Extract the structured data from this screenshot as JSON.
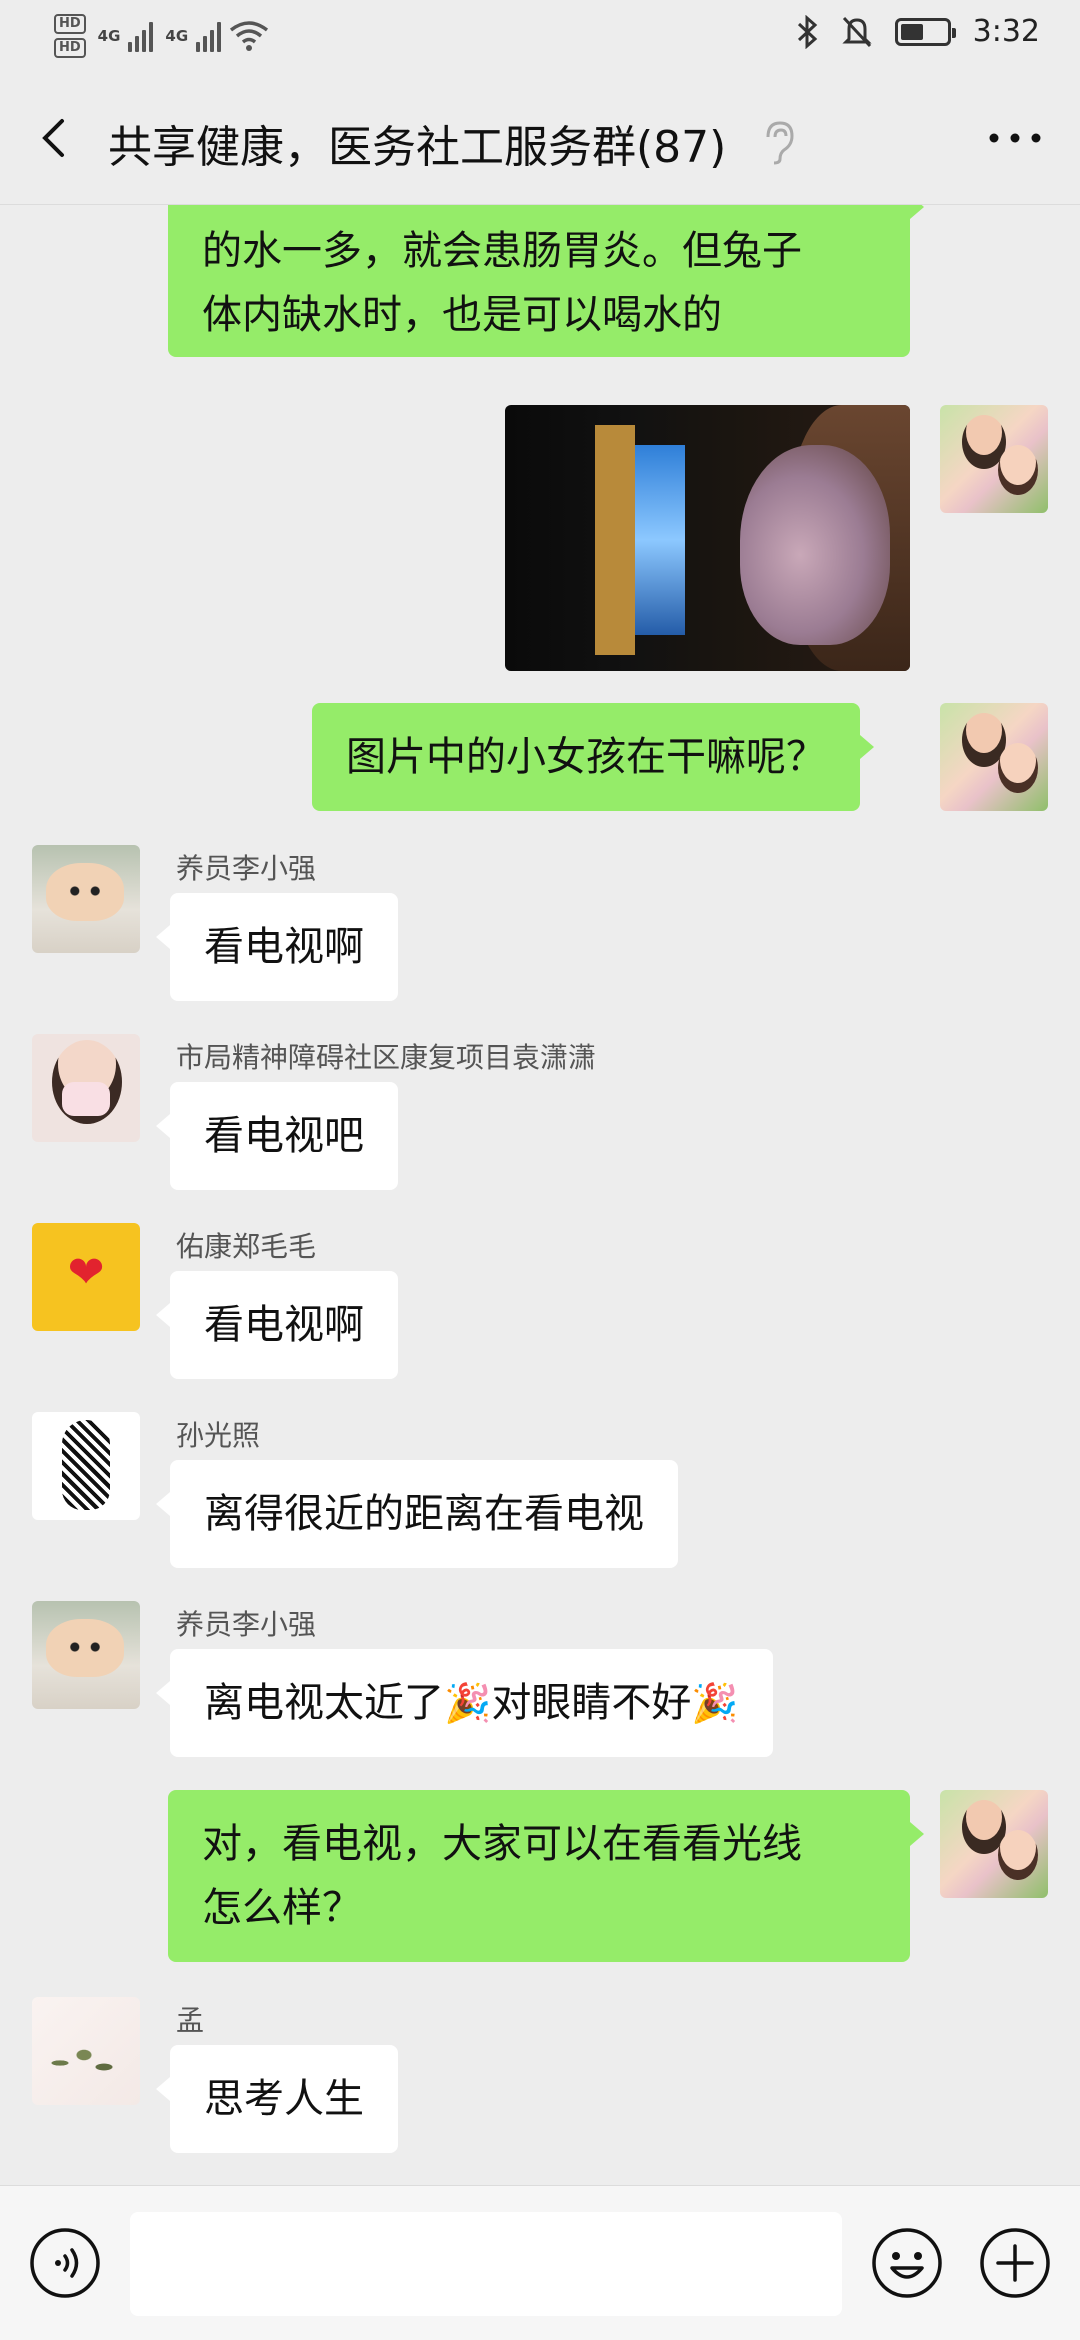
{
  "status_bar": {
    "hd1": "HD",
    "hd2": "HD",
    "net1": "4G",
    "net2": "4G",
    "time": "3:32",
    "icons": [
      "bluetooth-icon",
      "mute-bell-icon",
      "battery-icon",
      "wifi-icon",
      "signal-icon"
    ]
  },
  "header": {
    "title": "共享健康，医务社工服务群(87)",
    "icons": [
      "back-icon",
      "ear-icon",
      "more-icon"
    ]
  },
  "messages": [
    {
      "direction": "out",
      "lines": [
        "的水一多，就会患肠胃炎。但兔子",
        "体内缺水时，也是可以喝水的"
      ]
    },
    {
      "direction": "out",
      "type": "image"
    },
    {
      "direction": "out",
      "lines": [
        "图片中的小女孩在干嘛呢？"
      ]
    },
    {
      "direction": "in",
      "sender": "养员李小强",
      "lines": [
        "看电视啊"
      ]
    },
    {
      "direction": "in",
      "sender": "市局精神障碍社区康复项目袁潇潇",
      "lines": [
        "看电视吧"
      ]
    },
    {
      "direction": "in",
      "sender": "佑康郑毛毛",
      "lines": [
        "看电视啊"
      ]
    },
    {
      "direction": "in",
      "sender": "孙光照",
      "lines": [
        "离得很近的距离在看电视"
      ]
    },
    {
      "direction": "in",
      "sender": "养员李小强",
      "text_a": "离电视太近了",
      "emoji": "🎉",
      "text_b": "对眼睛不好",
      "emoji2": "🎉"
    },
    {
      "direction": "out",
      "lines": [
        "对，看电视，大家可以在看看光线",
        "怎么样？"
      ]
    },
    {
      "direction": "in",
      "sender": "孟",
      "lines": [
        "思考人生"
      ]
    }
  ],
  "input_bar": {
    "icons": [
      "voice-icon",
      "emoji-icon",
      "plus-icon"
    ]
  },
  "colors": {
    "background": "#ededed",
    "outgoing_bubble": "#95ec69",
    "incoming_bubble": "#ffffff"
  }
}
